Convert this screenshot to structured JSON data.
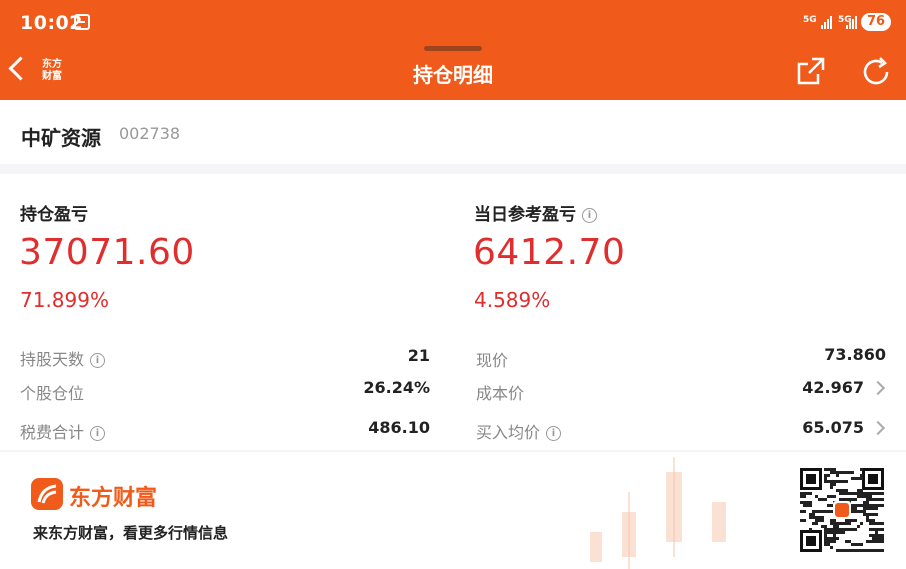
{
  "status_bar": {
    "time": "10:02",
    "signal1": "5G",
    "signal2": "5G",
    "battery": "76"
  },
  "nav": {
    "title": "持仓明细",
    "app_logo": "东方财富"
  },
  "stock": {
    "name": "中矿资源",
    "code": "002738"
  },
  "holding_pnl": {
    "label": "持仓盈亏",
    "value": "37071.60",
    "percent": "71.899%"
  },
  "daily_pnl": {
    "label": "当日参考盈亏",
    "value": "6412.70",
    "percent": "4.589%"
  },
  "details_left": [
    {
      "label": "持股天数",
      "value": "21"
    },
    {
      "label": "个股仓位",
      "value": "26.24%"
    },
    {
      "label": "税费合计",
      "value": "486.10"
    }
  ],
  "details_right": [
    {
      "label": "现价",
      "value": "73.860"
    },
    {
      "label": "成本价",
      "value": "42.967"
    },
    {
      "label": "买入均价",
      "value": "65.075"
    }
  ],
  "footer": {
    "brand": "东方财富",
    "slogan": "来东方财富，看更多行情信息"
  },
  "colors": {
    "brand": "#f05a1a",
    "profit": "#e02d2d"
  }
}
